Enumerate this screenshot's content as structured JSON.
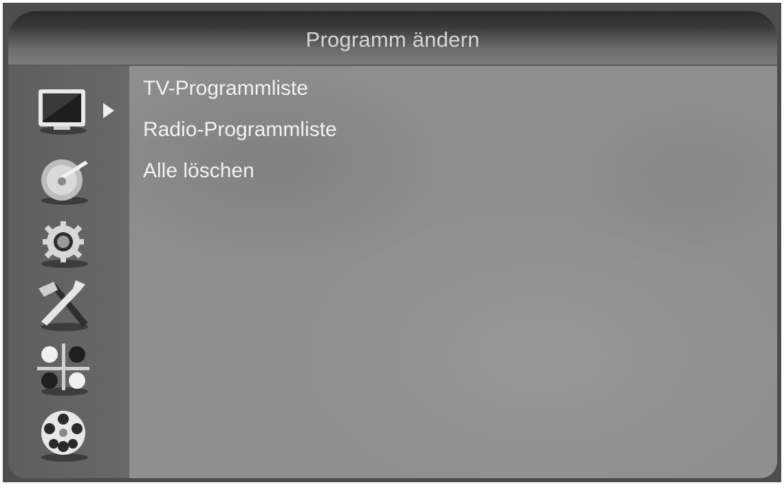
{
  "header": {
    "title": "Programm ändern"
  },
  "sidebar": {
    "icons": [
      {
        "name": "tv-icon"
      },
      {
        "name": "satellite-dish-icon"
      },
      {
        "name": "gear-icon"
      },
      {
        "name": "tools-icon"
      },
      {
        "name": "games-icon"
      },
      {
        "name": "film-reel-icon"
      }
    ],
    "selected_index": 0
  },
  "menu": {
    "items": [
      {
        "label": "TV-Programmliste"
      },
      {
        "label": "Radio-Programmliste"
      },
      {
        "label": "Alle löschen"
      }
    ]
  },
  "colors": {
    "title_text": "#d6d6d6",
    "menu_text": "#f2f2f2",
    "panel_bg": "#8f8f8f",
    "sidebar_bg": "#636363"
  }
}
